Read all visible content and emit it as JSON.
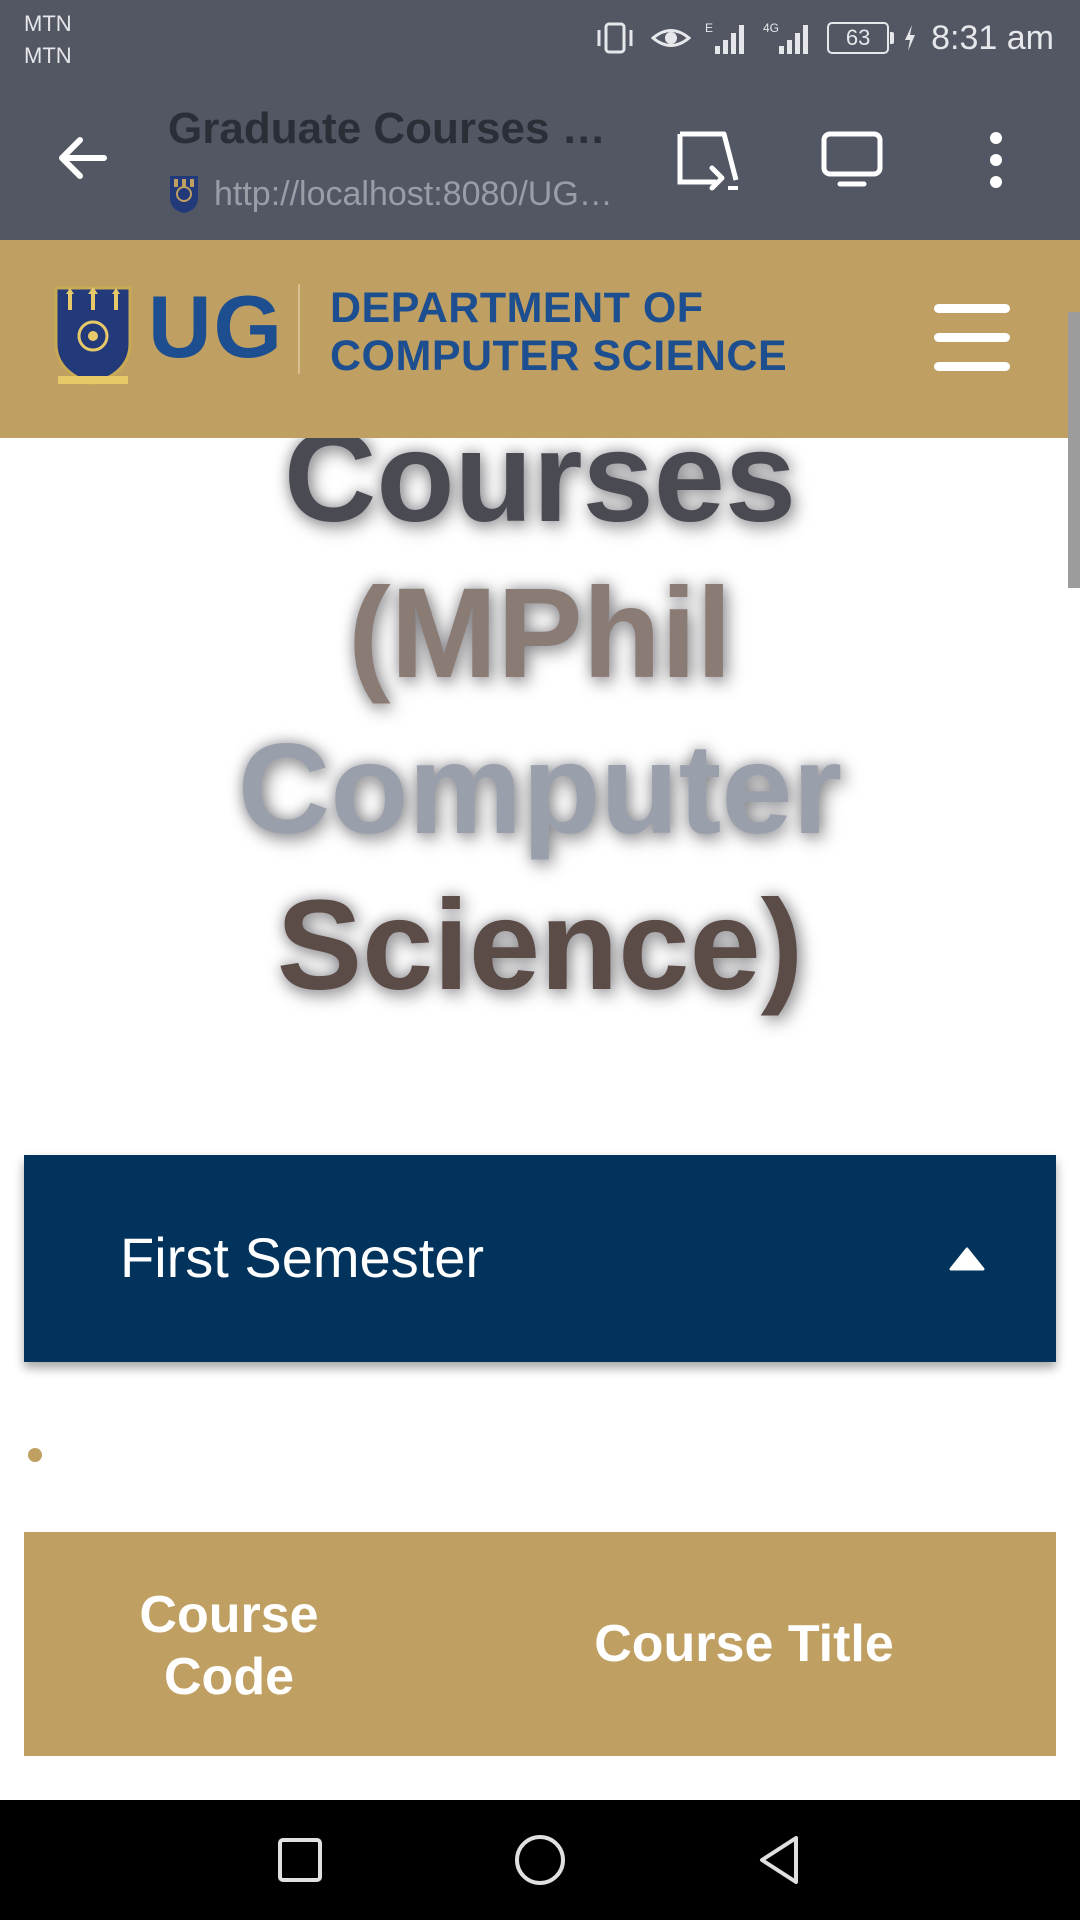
{
  "status_bar": {
    "carrier_1": "MTN",
    "carrier_2": "MTN",
    "network_1": "E",
    "network_2": "4G",
    "battery": "63",
    "time": "8:31 am"
  },
  "browser": {
    "page_title": "Graduate Courses (…",
    "url": "http://localhost:8080/UG…",
    "icons": [
      "back-arrow-icon",
      "cast-icon",
      "desktop-site-icon",
      "more-vert-icon"
    ]
  },
  "site_header": {
    "logo_text": "UG",
    "dept_line_1": "DEPARTMENT OF",
    "dept_line_2": "COMPUTER SCIENCE",
    "menu_icon": "hamburger-menu-icon",
    "colors": {
      "background": "#c0a062",
      "text": "#1d4e8f"
    }
  },
  "hero": {
    "line_1": "Courses",
    "line_2": "(MPhil",
    "line_3": "Computer",
    "line_4": "Science)"
  },
  "accordion": {
    "label": "First Semester",
    "state": "expanded",
    "color": "#02335d"
  },
  "table": {
    "headers": [
      "Course Code",
      "Course Title"
    ],
    "code_line_1": "Course",
    "code_line_2": "Code"
  }
}
